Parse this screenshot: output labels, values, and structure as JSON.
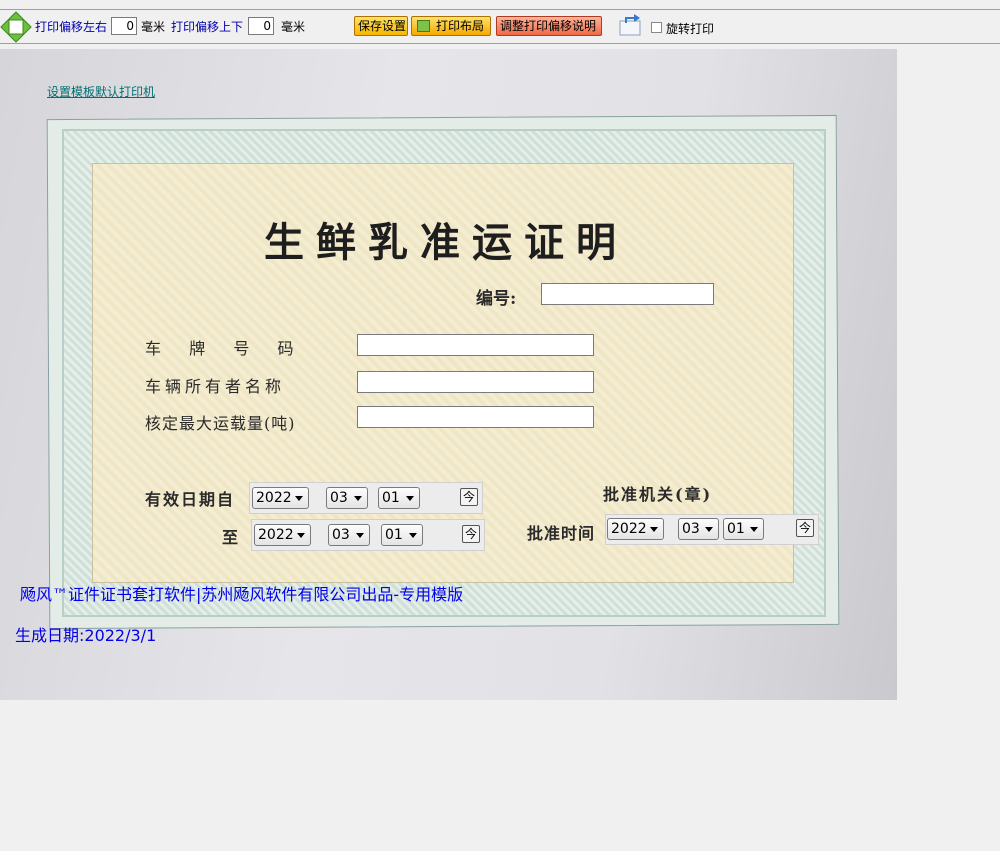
{
  "toolbar": {
    "offset_lr_label": "打印偏移左右",
    "offset_lr_value": "0",
    "offset_ud_label": "打印偏移上下",
    "offset_ud_value": "0",
    "unit_mm": "毫米",
    "save_label": "保存设置",
    "layout_label": "打印布局",
    "adjust_label": "调整打印偏移说明",
    "rotate_label": "旋转打印"
  },
  "certificate": {
    "set_default_printer_link": "设置模板默认打印机",
    "title": "生鲜乳准运证明",
    "serial_label": "编号:",
    "plate_label": "车  牌  号  码",
    "owner_label": "车辆所有者名称",
    "capacity_label": "核定最大运载量(吨)",
    "valid_from_label": "有效日期自",
    "valid_to_label": "至",
    "approval_authority_label": "批准机关(章)",
    "approval_time_label": "批准时间",
    "valid_from": {
      "year": "2022",
      "month": "03",
      "day": "01"
    },
    "valid_to": {
      "year": "2022",
      "month": "03",
      "day": "01"
    },
    "approval_date": {
      "year": "2022",
      "month": "03",
      "day": "01"
    },
    "today_button": "今"
  },
  "footer": {
    "credit": "飏风™证件证书套打软件|苏州飏风软件有限公司出品-专用模版",
    "generated_date": "生成日期:2022/3/1"
  }
}
